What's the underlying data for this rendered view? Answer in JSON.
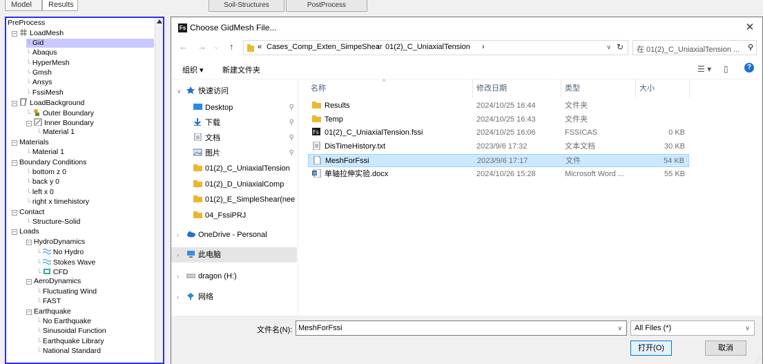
{
  "app": {
    "tabs": [
      "Model",
      "Results"
    ],
    "bg_tabs": [
      "Soil-Structures",
      "PostProcess"
    ]
  },
  "tree": {
    "items": [
      {
        "label": "PreProcess",
        "level": 0,
        "icon": ""
      },
      {
        "label": "LoadMesh",
        "level": 1,
        "icon": "mesh-icon"
      },
      {
        "label": "Gid",
        "level": 2,
        "icon": "",
        "selected": true
      },
      {
        "label": "Abaqus",
        "level": 2,
        "icon": ""
      },
      {
        "label": "HyperMesh",
        "level": 2,
        "icon": ""
      },
      {
        "label": "Gmsh",
        "level": 2,
        "icon": ""
      },
      {
        "label": "Ansys",
        "level": 2,
        "icon": ""
      },
      {
        "label": "FssiMesh",
        "level": 2,
        "icon": ""
      },
      {
        "label": "LoadBackground",
        "level": 1,
        "icon": "background-icon"
      },
      {
        "label": "Outer Boundary",
        "level": 2,
        "icon": "outer-boundary-icon"
      },
      {
        "label": "Inner Boundary",
        "level": 2,
        "icon": "inner-boundary-icon"
      },
      {
        "label": "Material 1",
        "level": 3,
        "icon": ""
      },
      {
        "label": "Materials",
        "level": 1,
        "icon": ""
      },
      {
        "label": "Material 1",
        "level": 2,
        "icon": ""
      },
      {
        "label": "Boundary Conditions",
        "level": 1,
        "icon": ""
      },
      {
        "label": "bottom z 0",
        "level": 2,
        "icon": ""
      },
      {
        "label": "back y 0",
        "level": 2,
        "icon": ""
      },
      {
        "label": "left x 0",
        "level": 2,
        "icon": ""
      },
      {
        "label": "right x timehistory",
        "level": 2,
        "icon": ""
      },
      {
        "label": "Contact",
        "level": 1,
        "icon": ""
      },
      {
        "label": "Structure-Solid",
        "level": 2,
        "icon": ""
      },
      {
        "label": "Loads",
        "level": 1,
        "icon": ""
      },
      {
        "label": "HydroDynamics",
        "level": 2,
        "icon": ""
      },
      {
        "label": "No Hydro",
        "level": 3,
        "icon": "wave-icon"
      },
      {
        "label": "Stokes Wave",
        "level": 3,
        "icon": "wave-icon"
      },
      {
        "label": "CFD",
        "level": 3,
        "icon": "cfd-icon"
      },
      {
        "label": "AeroDynamics",
        "level": 2,
        "icon": ""
      },
      {
        "label": "Fluctuating Wind",
        "level": 3,
        "icon": ""
      },
      {
        "label": "FAST",
        "level": 3,
        "icon": ""
      },
      {
        "label": "Earthquake",
        "level": 2,
        "icon": ""
      },
      {
        "label": "No Earthquake",
        "level": 3,
        "icon": ""
      },
      {
        "label": "Sinusoidal Function",
        "level": 3,
        "icon": ""
      },
      {
        "label": "Earthquake Library",
        "level": 3,
        "icon": ""
      },
      {
        "label": "National Standard",
        "level": 3,
        "icon": ""
      }
    ]
  },
  "dialog": {
    "title": "Choose GidMesh File...",
    "app_icon_text": "Fs",
    "breadcrumb": [
      "«",
      "Cases_Comp_Exten_SimpeShear",
      "›",
      "01(2)_C_UniaxialTension",
      "›"
    ],
    "search_placeholder": "在 01(2)_C_UniaxialTension ... ",
    "toolbar": {
      "organize": "组织 ▾",
      "new_folder": "新建文件夹"
    },
    "columns": [
      "名称",
      "修改日期",
      "类型",
      "大小"
    ],
    "nav": [
      {
        "label": "快速访问",
        "icon": "star-icon",
        "kind": "header"
      },
      {
        "label": "Desktop",
        "icon": "desktop-icon",
        "pin": true
      },
      {
        "label": "下载",
        "icon": "download-icon",
        "pin": true
      },
      {
        "label": "文档",
        "icon": "document-icon",
        "pin": true
      },
      {
        "label": "图片",
        "icon": "picture-icon",
        "pin": true
      },
      {
        "label": "01(2)_C_UniaxialTension",
        "icon": "folder-icon"
      },
      {
        "label": "01(2)_D_UniaxialComp",
        "icon": "folder-icon"
      },
      {
        "label": "01(2)_E_SimpleShear(nee",
        "icon": "folder-icon"
      },
      {
        "label": "04_FssiPRJ",
        "icon": "folder-icon"
      },
      {
        "label": "OneDrive - Personal",
        "icon": "cloud-icon",
        "kind": "header"
      },
      {
        "label": "此电脑",
        "icon": "computer-icon",
        "kind": "header",
        "selected": true
      },
      {
        "label": "dragon (H:)",
        "icon": "drive-icon",
        "kind": "header"
      },
      {
        "label": "网络",
        "icon": "network-icon",
        "kind": "header"
      }
    ],
    "files": [
      {
        "name": "Results",
        "date": "2024/10/25 16:44",
        "type": "文件夹",
        "size": "",
        "icon": "folder-icon"
      },
      {
        "name": "Temp",
        "date": "2024/10/25 16:43",
        "type": "文件夹",
        "size": "",
        "icon": "folder-icon"
      },
      {
        "name": "01(2)_C_UniaxialTension.fssi",
        "date": "2024/10/25 16:06",
        "type": "FSSICAS",
        "size": "0 KB",
        "icon": "fssi-file-icon"
      },
      {
        "name": "DisTimeHistory.txt",
        "date": "2023/9/6 17:32",
        "type": "文本文档",
        "size": "30 KB",
        "icon": "text-file-icon"
      },
      {
        "name": "MeshForFssi",
        "date": "2023/9/6 17:17",
        "type": "文件",
        "size": "54 KB",
        "icon": "file-icon",
        "selected": true
      },
      {
        "name": "单轴拉伸实验.docx",
        "date": "2024/10/26 15:28",
        "type": "Microsoft Word ...",
        "size": "55 KB",
        "icon": "word-file-icon"
      }
    ],
    "filename_label": "文件名(N):",
    "filename_value": "MeshForFssi",
    "filetype_value": "All Files (*)",
    "open_label": "打开(O)",
    "cancel_label": "取消"
  }
}
